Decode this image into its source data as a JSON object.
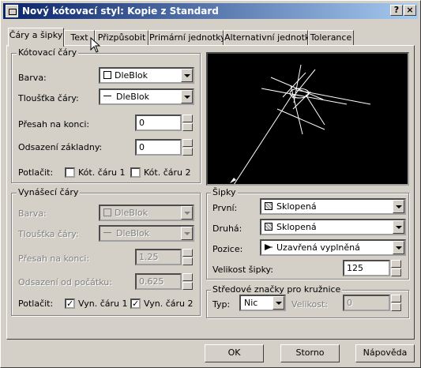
{
  "window": {
    "title": "Nový kótovací styl: Kopie z Standard",
    "help_label": "?",
    "close_label": "×"
  },
  "tabs": [
    "Čáry a šipky",
    "Text",
    "Přizpůsobit",
    "Primární jednotky",
    "Alternativní jednotky",
    "Tolerance"
  ],
  "dim_lines": {
    "title": "Kótovací čáry",
    "color_label": "Barva:",
    "color_value": "DleBlok",
    "lineweight_label": "Tloušťka čáry:",
    "lineweight_value": "DleBlok",
    "extend_label": "Přesah na konci:",
    "extend_value": "0",
    "baseline_label": "Odsazení základny:",
    "baseline_value": "0",
    "suppress_label": "Potlačit:",
    "suppress1_label": "Kót. čáru 1",
    "suppress2_label": "Kót. čáru 2",
    "suppress1": false,
    "suppress2": false
  },
  "ext_lines": {
    "title": "Vynášecí čáry",
    "color_label": "Barva:",
    "color_value": "DleBlok",
    "lineweight_label": "Tloušťka čáry:",
    "lineweight_value": "DleBlok",
    "extend_label": "Přesah na konci:",
    "extend_value": "1.25",
    "offset_label": "Odsazení od počátku:",
    "offset_value": "0.625",
    "suppress_label": "Potlačit:",
    "suppress1_label": "Vyn. čáru 1",
    "suppress2_label": "Vyn. čáru 2",
    "suppress1": true,
    "suppress2": true
  },
  "arrows": {
    "title": "Šipky",
    "first_label": "První:",
    "first_value": "Sklopená",
    "second_label": "Druhá:",
    "second_value": "Sklopená",
    "leader_label": "Pozice:",
    "leader_value": "Uzavřená vyplněná",
    "size_label": "Velikost šipky:",
    "size_value": "125"
  },
  "center_marks": {
    "title": "Středové značky pro kružnice",
    "type_label": "Typ:",
    "type_value": "Nic",
    "size_label": "Velikost:",
    "size_value": "0"
  },
  "buttons": {
    "ok": "OK",
    "cancel": "Storno",
    "help": "Nápověda"
  },
  "check_mark": "✓"
}
